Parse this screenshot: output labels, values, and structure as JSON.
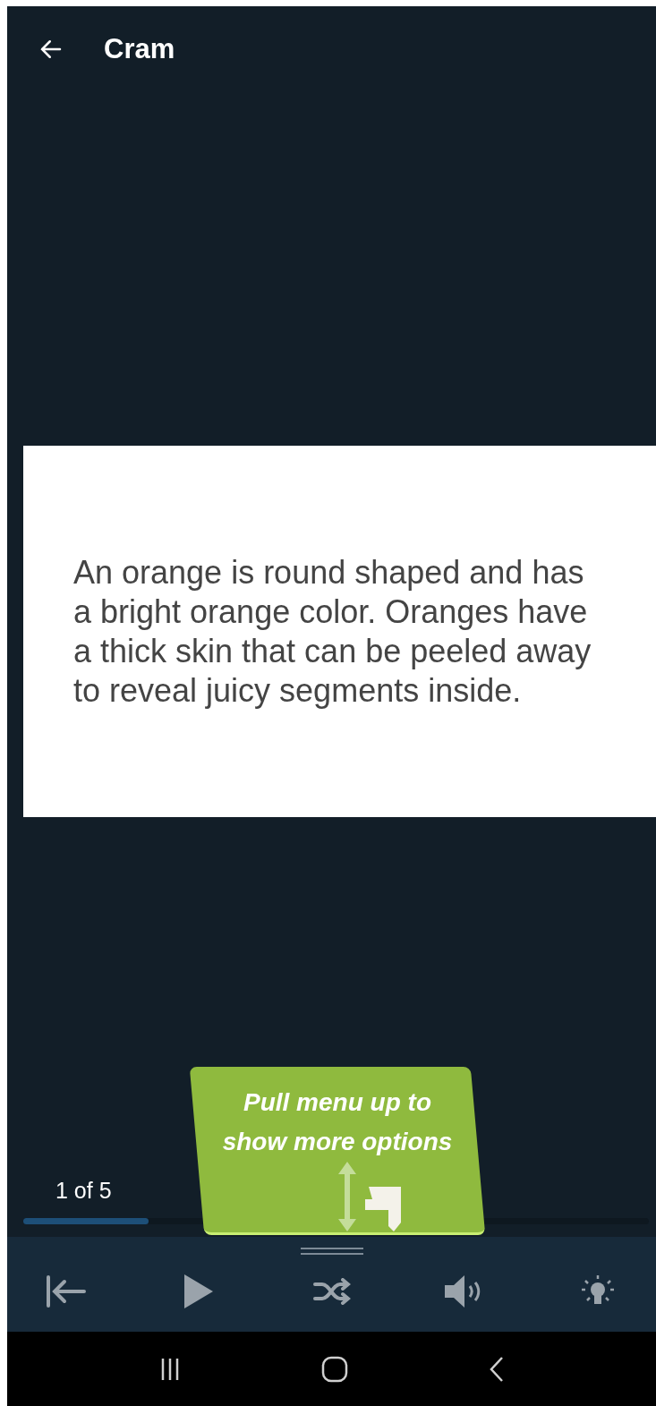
{
  "header": {
    "title": "Cram"
  },
  "card": {
    "text": "An orange is round shaped and has a bright orange color. Oranges have a thick skin that can be peeled away to reveal juicy segments inside."
  },
  "progress": {
    "label": "1 of 5",
    "level": 0.2
  },
  "tooltip": {
    "text": "Pull menu up to show more options"
  }
}
